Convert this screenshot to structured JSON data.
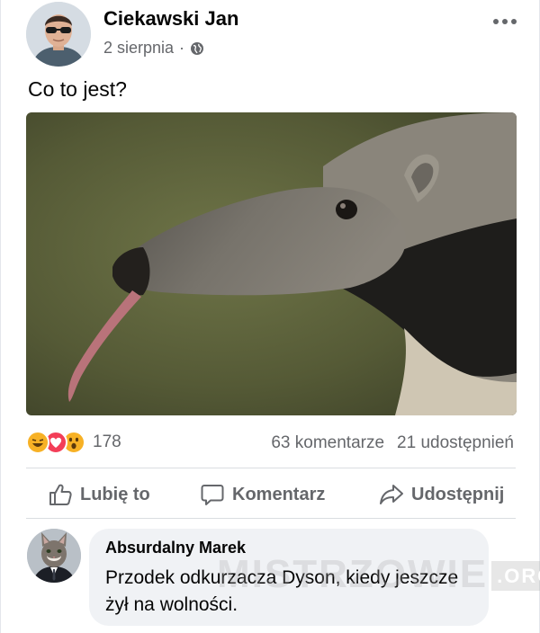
{
  "post": {
    "author": "Ciekawski Jan",
    "date": "2 sierpnia",
    "separator": "·",
    "text": "Co to jest?",
    "photo_subject": "anteater-photo"
  },
  "stats": {
    "reaction_count": "178",
    "reactions": [
      "laugh",
      "love",
      "wow"
    ],
    "comments": "63 komentarze",
    "shares": "21 udostępnień"
  },
  "actions": {
    "like": "Lubię to",
    "comment": "Komentarz",
    "share": "Udostępnij"
  },
  "comment": {
    "author": "Absurdalny Marek",
    "text": "Przodek odkurzacza Dyson, kiedy jeszcze żył na wolności."
  },
  "watermark": {
    "text": "MISTRZOWIE",
    "suffix": ".ORG"
  },
  "colors": {
    "text_primary": "#050505",
    "text_secondary": "#65676b",
    "bubble": "#f0f2f5",
    "love": "#f33e58",
    "reaction_yellow": "#f7b125"
  }
}
